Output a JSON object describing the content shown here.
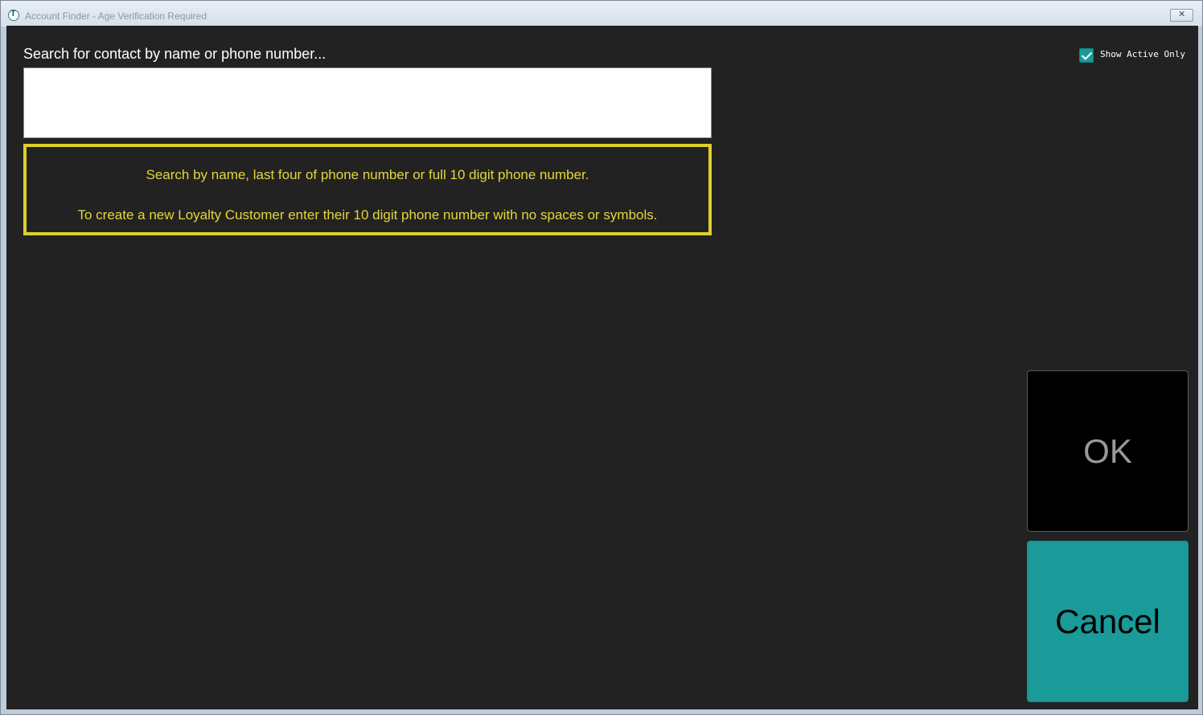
{
  "window": {
    "title": "Account Finder - Age Verification Required",
    "app_icon": "app-logo-icon",
    "close_icon": "close-icon"
  },
  "search": {
    "label": "Search for contact by name or phone number...",
    "value": "",
    "placeholder": ""
  },
  "hint": {
    "line1": "Search by name, last four of phone number or full 10 digit phone number.",
    "line2": "To create a new Loyalty Customer enter their 10 digit phone number with no spaces or symbols."
  },
  "filter": {
    "show_active_label": "Show Active Only",
    "show_active_checked": true
  },
  "actions": {
    "ok_label": "OK",
    "cancel_label": "Cancel"
  },
  "colors": {
    "background": "#222222",
    "hint_text": "#e3d63a",
    "hint_border": "#dcd12a",
    "accent": "#1a9a98"
  }
}
